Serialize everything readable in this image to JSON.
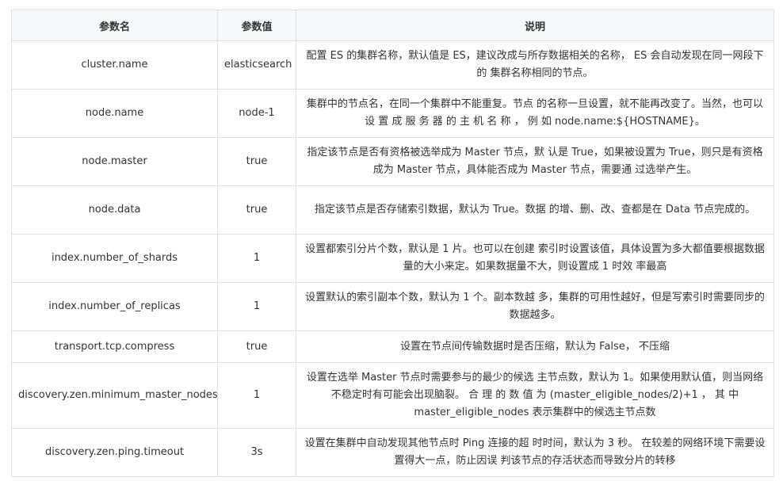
{
  "headers": {
    "name": "参数名",
    "value": "参数值",
    "desc": "说明"
  },
  "rows": [
    {
      "name": "cluster.name",
      "value": "elasticsearch",
      "desc": "配置 ES 的集群名称，默认值是 ES，建议改成与所存数据相关的名称， ES 会自动发现在同一网段下的 集群名称相同的节点。"
    },
    {
      "name": "node.name",
      "value": "node-1",
      "desc": "集群中的节点名，在同一个集群中不能重复。节点 的名称一旦设置，就不能再改变了。当然，也可以 设 置 成 服 务 器 的 主 机 名 称 ， 例 如 node.name:${HOSTNAME}。"
    },
    {
      "name": "node.master",
      "value": "true",
      "desc": "指定该节点是否有资格被选举成为 Master 节点，默 认是 True，如果被设置为 True，则只是有资格成为 Master 节点，具体能否成为 Master 节点，需要通 过选举产生。"
    },
    {
      "name": "node.data",
      "value": "true",
      "desc": "指定该节点是否存储索引数据，默认为 True。数据 的增、删、改、查都是在 Data 节点完成的。"
    },
    {
      "name": "index.number_of_shards",
      "value": "1",
      "desc": "设置都索引分片个数，默认是 1 片。也可以在创建 索引时设置该值，具体设置为多大都值要根据数据 量的大小来定。如果数据量不大，则设置成 1 时效 率最高"
    },
    {
      "name": "index.number_of_replicas",
      "value": "1",
      "desc": "设置默认的索引副本个数，默认为 1 个。副本数越 多，集群的可用性越好，但是写索引时需要同步的 数据越多。"
    },
    {
      "name": "transport.tcp.compress",
      "value": "true",
      "desc": "设置在节点间传输数据时是否压缩，默认为 False， 不压缩"
    },
    {
      "name": "discovery.zen.minimum_master_nodes",
      "value": "1",
      "desc": "设置在选举 Master 节点时需要参与的最少的候选 主节点数，默认为 1。如果使用默认值，则当网络 不稳定时有可能会出现脑裂。 合 理 的 数 值 为 (master_eligible_nodes/2)+1 ， 其 中 master_eligible_nodes 表示集群中的候选主节点数"
    },
    {
      "name": "discovery.zen.ping.timeout",
      "value": "3s",
      "desc": "设置在集群中自动发现其他节点时 Ping 连接的超 时时间，默认为 3 秒。 在较差的网络环境下需要设置得大一点，防止因误 判该节点的存活状态而导致分片的转移"
    }
  ]
}
